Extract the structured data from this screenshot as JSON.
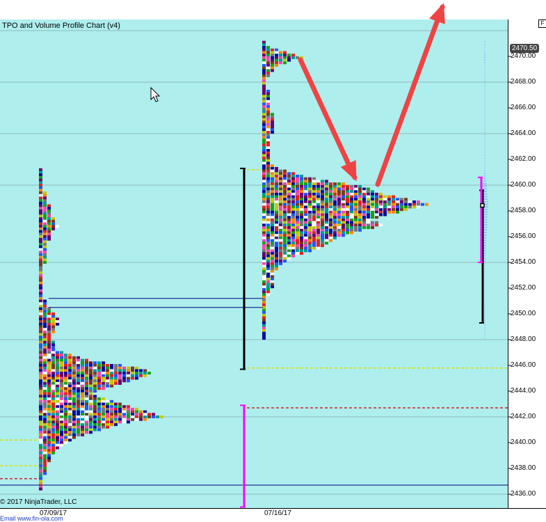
{
  "window": {
    "chart_title": "TPO and Volume Profile Chart (v4)",
    "corner_button": "F",
    "copyright": "© 2017 NinjaTrader, LLC",
    "footer_link": "Email  www.fin-ola.com"
  },
  "price_axis": {
    "ticks": [
      "2470.00",
      "2468.00",
      "2466.00",
      "2464.00",
      "2462.00",
      "2460.00",
      "2458.00",
      "2456.00",
      "2454.00",
      "2452.00",
      "2450.00",
      "2448.00",
      "2446.00",
      "2444.00",
      "2442.00",
      "2440.00",
      "2438.00",
      "2436.00"
    ],
    "tick_values": [
      2470,
      2468,
      2466,
      2464,
      2462,
      2460,
      2458,
      2456,
      2454,
      2452,
      2450,
      2448,
      2446,
      2444,
      2442,
      2440,
      2438,
      2436
    ],
    "last_price": "2470.50"
  },
  "date_axis": {
    "labels": [
      "07/09/17",
      "07/16/17"
    ]
  },
  "colors": {
    "background": "#aeeeed",
    "arrow": "#ee4444",
    "value_area_bar": "#ff00ff",
    "poc_dashed": "#cc2222",
    "yellow_dashed": "#dddd00",
    "level_line": "#000080",
    "tpo_palette": [
      "#e52121",
      "#0a0a9a",
      "#1aa01a",
      "#c8c800",
      "#7a3a1a",
      "#6a006a",
      "#009a9a",
      "#ff8800",
      "#777777",
      "#ffffff",
      "#2255ff",
      "#ff44aa"
    ]
  },
  "profiles": {
    "week1": {
      "label": "07/09/17",
      "high": 2461.3,
      "low": 2436.2,
      "poc": 2442.0,
      "rows": [
        [
          2461.2,
          1
        ],
        [
          2461.0,
          1
        ],
        [
          2460.8,
          1
        ],
        [
          2460.6,
          1
        ],
        [
          2460.4,
          1
        ],
        [
          2460.2,
          1
        ],
        [
          2460.0,
          1
        ],
        [
          2459.8,
          1
        ],
        [
          2459.6,
          1
        ],
        [
          2459.4,
          2
        ],
        [
          2459.2,
          2
        ],
        [
          2459.0,
          2
        ],
        [
          2458.8,
          2
        ],
        [
          2458.6,
          2
        ],
        [
          2458.4,
          3
        ],
        [
          2458.2,
          3
        ],
        [
          2458.0,
          3
        ],
        [
          2457.8,
          3
        ],
        [
          2457.6,
          3
        ],
        [
          2457.4,
          4
        ],
        [
          2457.2,
          4
        ],
        [
          2457.0,
          4
        ],
        [
          2456.8,
          5
        ],
        [
          2456.6,
          4
        ],
        [
          2456.4,
          3
        ],
        [
          2456.2,
          3
        ],
        [
          2456.0,
          3
        ],
        [
          2455.8,
          3
        ],
        [
          2455.6,
          2
        ],
        [
          2455.4,
          2
        ],
        [
          2455.2,
          2
        ],
        [
          2455.0,
          2
        ],
        [
          2454.8,
          2
        ],
        [
          2454.6,
          2
        ],
        [
          2454.4,
          2
        ],
        [
          2454.2,
          2
        ],
        [
          2454.0,
          2
        ],
        [
          2453.8,
          1
        ],
        [
          2453.6,
          1
        ],
        [
          2453.4,
          1
        ],
        [
          2453.2,
          1
        ],
        [
          2453.0,
          1
        ],
        [
          2452.8,
          1
        ],
        [
          2452.6,
          1
        ],
        [
          2452.4,
          1
        ],
        [
          2452.2,
          1
        ],
        [
          2452.0,
          1
        ],
        [
          2451.8,
          1
        ],
        [
          2451.6,
          1
        ],
        [
          2451.4,
          1
        ],
        [
          2451.2,
          1
        ],
        [
          2451.0,
          2
        ],
        [
          2450.8,
          2
        ],
        [
          2450.6,
          2
        ],
        [
          2450.4,
          3
        ],
        [
          2450.2,
          3
        ],
        [
          2450.0,
          4
        ],
        [
          2449.8,
          4
        ],
        [
          2449.6,
          5
        ],
        [
          2449.4,
          5
        ],
        [
          2449.2,
          5
        ],
        [
          2449.0,
          4
        ],
        [
          2448.8,
          4
        ],
        [
          2448.6,
          4
        ],
        [
          2448.4,
          3
        ],
        [
          2448.2,
          3
        ],
        [
          2448.0,
          3
        ],
        [
          2447.8,
          4
        ],
        [
          2447.6,
          4
        ],
        [
          2447.4,
          4
        ],
        [
          2447.2,
          4
        ],
        [
          2447.0,
          6
        ],
        [
          2446.8,
          8
        ],
        [
          2446.6,
          10
        ],
        [
          2446.4,
          12
        ],
        [
          2446.2,
          16
        ],
        [
          2446.0,
          20
        ],
        [
          2445.8,
          24
        ],
        [
          2445.6,
          26
        ],
        [
          2445.4,
          27
        ],
        [
          2445.2,
          26
        ],
        [
          2445.0,
          24
        ],
        [
          2444.8,
          22
        ],
        [
          2444.6,
          20
        ],
        [
          2444.4,
          18
        ],
        [
          2444.2,
          16
        ],
        [
          2444.0,
          14
        ],
        [
          2443.8,
          13
        ],
        [
          2443.6,
          14
        ],
        [
          2443.4,
          16
        ],
        [
          2443.2,
          18
        ],
        [
          2443.0,
          20
        ],
        [
          2442.8,
          22
        ],
        [
          2442.6,
          24
        ],
        [
          2442.4,
          26
        ],
        [
          2442.2,
          28
        ],
        [
          2442.0,
          30
        ],
        [
          2441.8,
          26
        ],
        [
          2441.6,
          22
        ],
        [
          2441.4,
          19
        ],
        [
          2441.2,
          17
        ],
        [
          2441.0,
          15
        ],
        [
          2440.8,
          13
        ],
        [
          2440.6,
          11
        ],
        [
          2440.4,
          9
        ],
        [
          2440.2,
          8
        ],
        [
          2440.0,
          7
        ],
        [
          2439.8,
          6
        ],
        [
          2439.6,
          5
        ],
        [
          2439.4,
          4
        ],
        [
          2439.2,
          4
        ],
        [
          2439.0,
          3
        ],
        [
          2438.8,
          3
        ],
        [
          2438.6,
          3
        ],
        [
          2438.4,
          2
        ],
        [
          2438.2,
          2
        ],
        [
          2438.0,
          2
        ],
        [
          2437.8,
          2
        ],
        [
          2437.6,
          2
        ],
        [
          2437.4,
          1
        ],
        [
          2437.2,
          1
        ],
        [
          2437.0,
          1
        ],
        [
          2436.8,
          1
        ],
        [
          2436.6,
          1
        ],
        [
          2436.4,
          1
        ]
      ]
    },
    "week2": {
      "label": "07/16/17",
      "high": 2471.2,
      "low": 2448.0,
      "poc": 2458.4,
      "rows": [
        [
          2471.1,
          1
        ],
        [
          2470.9,
          1
        ],
        [
          2470.7,
          2
        ],
        [
          2470.5,
          4
        ],
        [
          2470.3,
          6
        ],
        [
          2470.1,
          8
        ],
        [
          2469.9,
          10
        ],
        [
          2469.7,
          7
        ],
        [
          2469.5,
          6
        ],
        [
          2469.3,
          4
        ],
        [
          2469.1,
          3
        ],
        [
          2468.9,
          3
        ],
        [
          2468.7,
          2
        ],
        [
          2468.5,
          2
        ],
        [
          2468.3,
          1
        ],
        [
          2468.1,
          1
        ],
        [
          2467.9,
          1
        ],
        [
          2467.7,
          1
        ],
        [
          2467.5,
          1
        ],
        [
          2467.3,
          2
        ],
        [
          2467.1,
          2
        ],
        [
          2466.9,
          2
        ],
        [
          2466.7,
          2
        ],
        [
          2466.5,
          2
        ],
        [
          2466.3,
          2
        ],
        [
          2466.1,
          2
        ],
        [
          2465.9,
          2
        ],
        [
          2465.7,
          2
        ],
        [
          2465.5,
          3
        ],
        [
          2465.3,
          3
        ],
        [
          2465.1,
          3
        ],
        [
          2464.9,
          3
        ],
        [
          2464.7,
          3
        ],
        [
          2464.5,
          3
        ],
        [
          2464.3,
          3
        ],
        [
          2464.1,
          3
        ],
        [
          2463.9,
          2
        ],
        [
          2463.7,
          2
        ],
        [
          2463.5,
          2
        ],
        [
          2463.3,
          2
        ],
        [
          2463.1,
          2
        ],
        [
          2462.9,
          2
        ],
        [
          2462.7,
          2
        ],
        [
          2462.5,
          2
        ],
        [
          2462.3,
          2
        ],
        [
          2462.1,
          2
        ],
        [
          2461.9,
          2
        ],
        [
          2461.7,
          2
        ],
        [
          2461.5,
          3
        ],
        [
          2461.3,
          4
        ],
        [
          2461.1,
          6
        ],
        [
          2460.9,
          8
        ],
        [
          2460.7,
          10
        ],
        [
          2460.5,
          13
        ],
        [
          2460.3,
          16
        ],
        [
          2460.1,
          20
        ],
        [
          2459.9,
          24
        ],
        [
          2459.7,
          26
        ],
        [
          2459.5,
          27
        ],
        [
          2459.3,
          29
        ],
        [
          2459.1,
          32
        ],
        [
          2458.9,
          35
        ],
        [
          2458.7,
          38
        ],
        [
          2458.5,
          40
        ],
        [
          2458.3,
          38
        ],
        [
          2458.1,
          35
        ],
        [
          2457.9,
          33
        ],
        [
          2457.7,
          30
        ],
        [
          2457.5,
          28
        ],
        [
          2457.3,
          26
        ],
        [
          2457.1,
          28
        ],
        [
          2456.9,
          29
        ],
        [
          2456.7,
          27
        ],
        [
          2456.5,
          24
        ],
        [
          2456.3,
          22
        ],
        [
          2456.1,
          20
        ],
        [
          2455.9,
          18
        ],
        [
          2455.7,
          17
        ],
        [
          2455.5,
          16
        ],
        [
          2455.3,
          15
        ],
        [
          2455.1,
          14
        ],
        [
          2454.9,
          12
        ],
        [
          2454.7,
          10
        ],
        [
          2454.5,
          8
        ],
        [
          2454.3,
          7
        ],
        [
          2454.1,
          6
        ],
        [
          2453.9,
          5
        ],
        [
          2453.7,
          4
        ],
        [
          2453.5,
          4
        ],
        [
          2453.3,
          3
        ],
        [
          2453.1,
          3
        ],
        [
          2452.9,
          3
        ],
        [
          2452.7,
          3
        ],
        [
          2452.5,
          3
        ],
        [
          2452.3,
          3
        ],
        [
          2452.1,
          3
        ],
        [
          2451.9,
          2
        ],
        [
          2451.7,
          2
        ],
        [
          2451.5,
          2
        ],
        [
          2451.3,
          1
        ],
        [
          2451.1,
          1
        ],
        [
          2450.9,
          1
        ],
        [
          2450.7,
          1
        ],
        [
          2450.5,
          1
        ],
        [
          2450.3,
          1
        ],
        [
          2450.1,
          1
        ],
        [
          2449.9,
          1
        ],
        [
          2449.7,
          1
        ],
        [
          2449.5,
          1
        ],
        [
          2449.3,
          1
        ],
        [
          2449.1,
          1
        ],
        [
          2448.9,
          1
        ],
        [
          2448.7,
          1
        ],
        [
          2448.5,
          1
        ],
        [
          2448.3,
          1
        ],
        [
          2448.1,
          1
        ]
      ]
    }
  },
  "levels": {
    "red_dashed": [
      2442.7,
      2437.2
    ],
    "yellow_dashed": [
      2445.8,
      2440.2,
      2438.2,
      2461.2
    ],
    "navy_lines": [
      2451.2,
      2450.5,
      2436.7
    ],
    "value_area_black": {
      "high": 2461.3,
      "low": 2445.7
    },
    "value_area_magenta_w1": {
      "high": 2442.9,
      "low": 2435.0
    },
    "value_area_black_current": {
      "high": 2459.6,
      "low": 2449.3
    },
    "value_area_magenta_current": {
      "high": 2460.6,
      "low": 2454.0
    },
    "current_marker": 2458.4
  }
}
